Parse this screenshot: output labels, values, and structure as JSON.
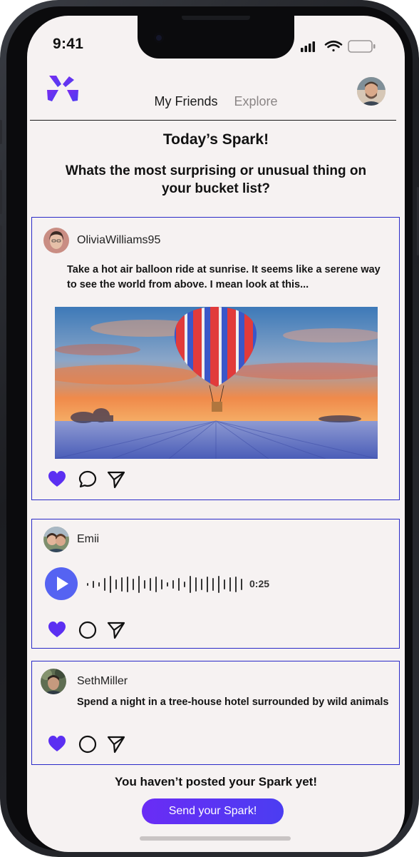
{
  "status_bar": {
    "time": "9:41"
  },
  "header": {
    "tabs": [
      {
        "label": "My Friends",
        "active": true
      },
      {
        "label": "Explore",
        "active": false
      }
    ]
  },
  "spark": {
    "title": "Today’s Spark!",
    "question": "Whats the most surprising or unusual thing on your bucket list?"
  },
  "posts": [
    {
      "username": "OliviaWilliams95",
      "type": "text-image",
      "text": "Take a hot air balloon ride at sunrise. It seems like a serene way to see the world from above. I mean look at this...",
      "image": "hot-air-balloon-sunrise-photo"
    },
    {
      "username": "Emii",
      "type": "audio",
      "duration": "0:25"
    },
    {
      "username": "SethMiller",
      "type": "text",
      "text": "Spend a night in a tree-house hotel surrounded by wild animals"
    }
  ],
  "footer": {
    "prompt": "You haven’t posted your Spark yet!",
    "cta_label": "Send your Spark!"
  },
  "colors": {
    "accent": "#5b2ff2",
    "card_border": "#2a2ac8",
    "background": "#f6f2f2"
  }
}
